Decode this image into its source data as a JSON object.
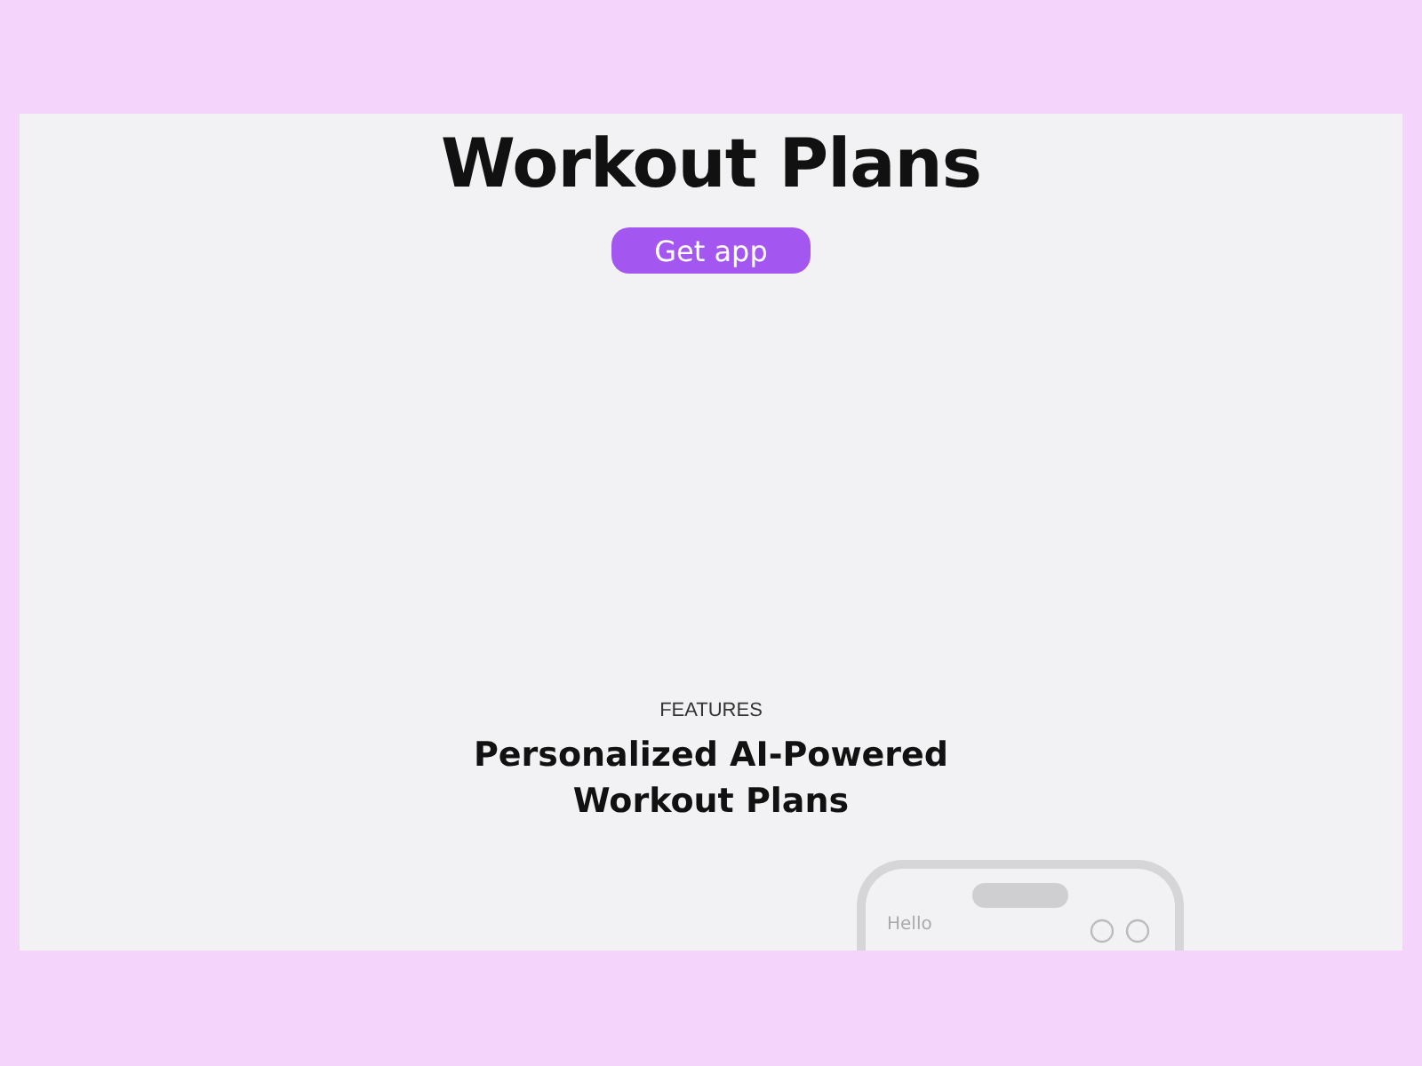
{
  "hero": {
    "title": "Workout Plans",
    "button": "Get app"
  },
  "features": {
    "eyebrow": "FEATURES",
    "heading": "Personalized AI-Powered Workout Plans"
  },
  "phone": {
    "greeting": "Hello"
  }
}
